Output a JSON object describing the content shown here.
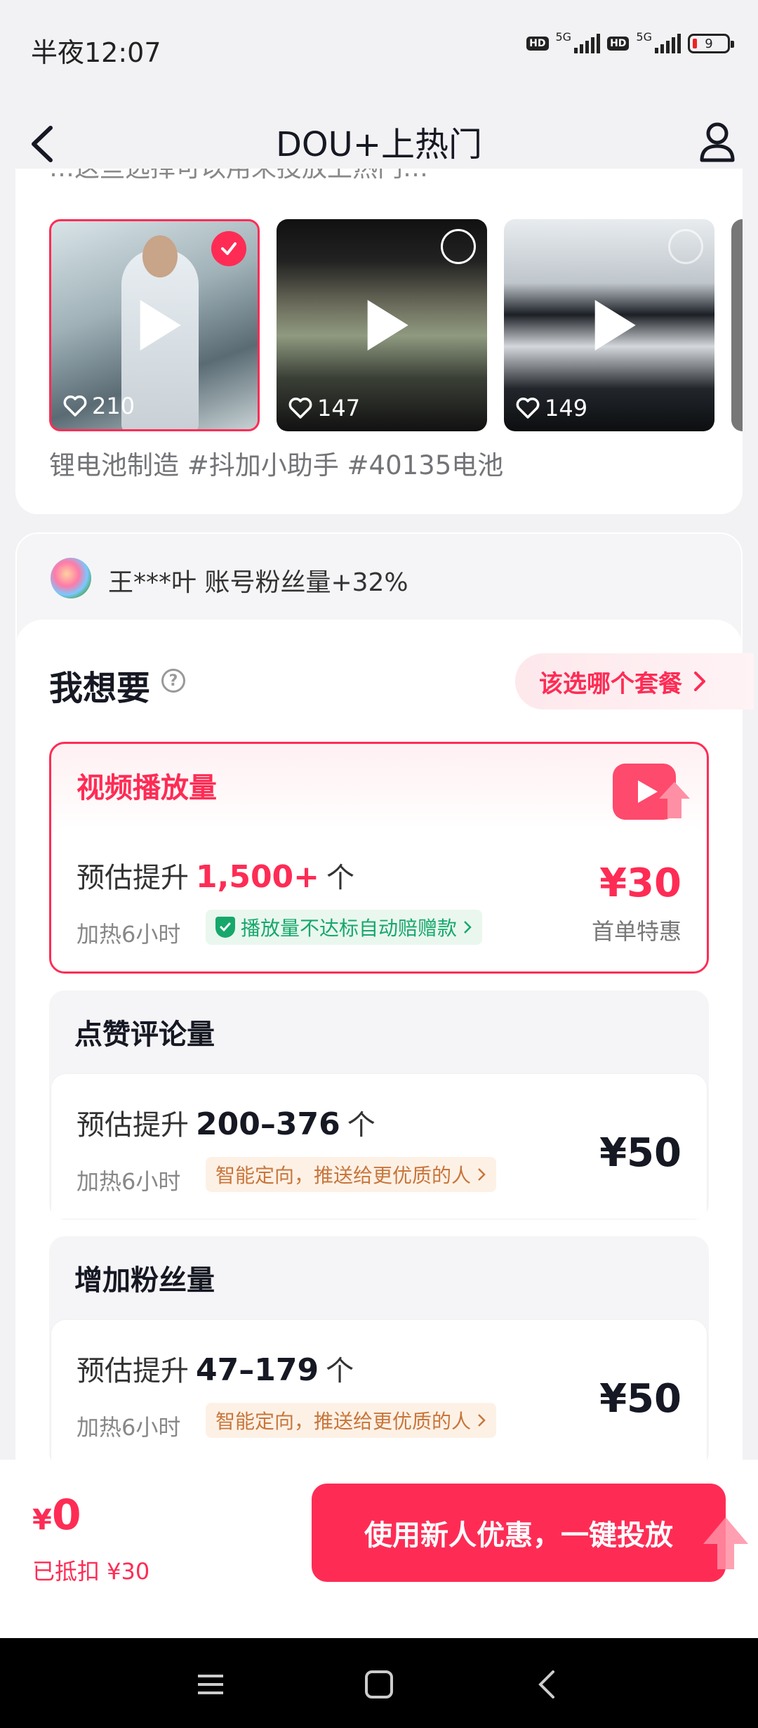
{
  "status": {
    "time": "半夜12:07",
    "hd": "HD",
    "net1": "5G",
    "net2": "5G",
    "battery": "9"
  },
  "header": {
    "title": "DOU+上热门"
  },
  "videos": {
    "cut_text": "…这些选择可以用来投放上热门…",
    "items": [
      {
        "likes": "210",
        "selected": true
      },
      {
        "likes": "147",
        "selected": false
      },
      {
        "likes": "149",
        "selected": false
      }
    ],
    "caption": "锂电池制造 #抖加小助手 #40135电池"
  },
  "account": {
    "label": "王***叶   账号粉丝量+32%"
  },
  "goal": {
    "title": "我想要",
    "help": "?",
    "which_label": "该选哪个套餐"
  },
  "packages": [
    {
      "title": "视频播放量",
      "est_prefix": "预估提升",
      "est_value": "1,500+",
      "est_unit": "个",
      "hours": "加热6小时",
      "tag": "播放量不达标自动赔赠款",
      "price": "¥30",
      "note": "首单特惠"
    },
    {
      "title": "点赞评论量",
      "est_prefix": "预估提升",
      "est_value": "200–376",
      "est_unit": "个",
      "hours": "加热6小时",
      "tag": "智能定向，推送给更优质的人",
      "price": "¥50"
    },
    {
      "title": "增加粉丝量",
      "est_prefix": "预估提升",
      "est_value": "47–179",
      "est_unit": "个",
      "hours": "加热6小时",
      "tag": "智能定向，推送给更优质的人",
      "price": "¥50"
    }
  ],
  "footer": {
    "currency": "¥",
    "total": "0",
    "deduct": "已抵扣 ¥30",
    "cta": "使用新人优惠，一键投放"
  },
  "colors": {
    "accent": "#fe2c55",
    "green": "#16a86b",
    "orange": "#c8763b"
  }
}
